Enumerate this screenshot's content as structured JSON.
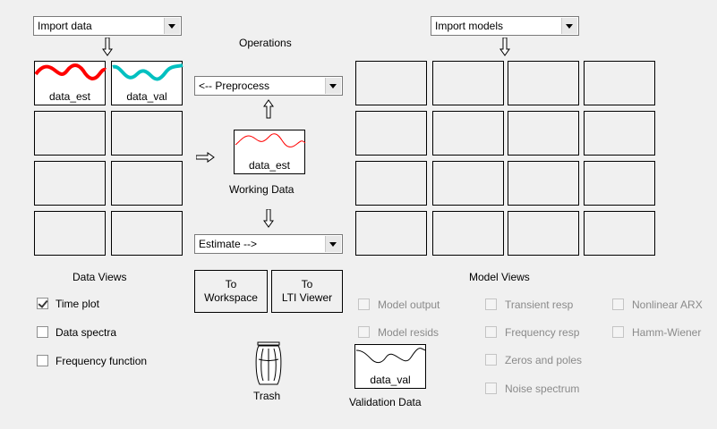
{
  "data_panel": {
    "import_label": "Import data",
    "title": "Data Views",
    "slots": [
      {
        "label": "data_est",
        "curve": "red"
      },
      {
        "label": "data_val",
        "curve": "cyan"
      }
    ],
    "checkboxes": [
      {
        "label": "Time plot",
        "checked": true
      },
      {
        "label": "Data spectra",
        "checked": false
      },
      {
        "label": "Frequency function",
        "checked": false
      }
    ]
  },
  "operations": {
    "title": "Operations",
    "preprocess_label": "<-- Preprocess",
    "estimate_label": "Estimate -->",
    "working_data": {
      "name": "data_est",
      "caption": "Working Data"
    },
    "to_workspace": {
      "line1": "To",
      "line2": "Workspace"
    },
    "to_lti": {
      "line1": "To",
      "line2": "LTI Viewer"
    },
    "trash_label": "Trash",
    "validation": {
      "name": "data_val",
      "caption": "Validation Data"
    }
  },
  "model_panel": {
    "import_label": "Import models",
    "title": "Model Views",
    "checkboxes": [
      {
        "label": "Model output",
        "checked": false
      },
      {
        "label": "Model resids",
        "checked": false
      },
      {
        "label": "Transient resp",
        "checked": false
      },
      {
        "label": "Frequency resp",
        "checked": false
      },
      {
        "label": "Zeros and poles",
        "checked": false
      },
      {
        "label": "Noise spectrum",
        "checked": false
      },
      {
        "label": "Nonlinear ARX",
        "checked": false
      },
      {
        "label": "Hamm-Wiener",
        "checked": false
      }
    ]
  },
  "colors": {
    "est_curve": "#ff0000",
    "val_curve": "#00c0c0",
    "working_curve": "#ff0000",
    "validation_curve": "#000000"
  },
  "icons": [
    "arrow-down-icon",
    "arrow-up-icon",
    "arrow-right-icon",
    "trash-icon"
  ]
}
